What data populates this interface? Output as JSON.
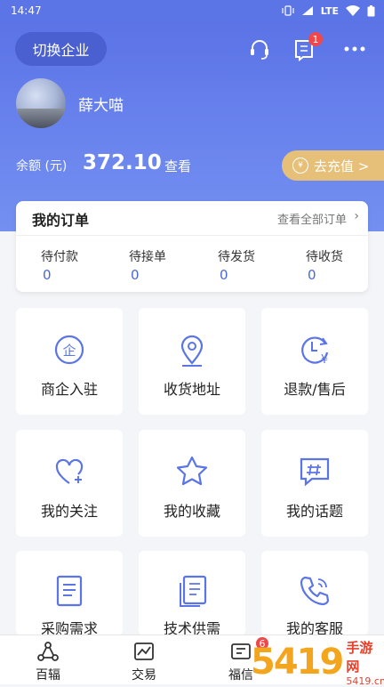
{
  "status_bar": {
    "time": "14:47",
    "network": "LTE"
  },
  "header": {
    "switch_label": "切换企业",
    "message_badge": "1",
    "username": "薛大喵",
    "balance_label": "余额 (元)",
    "balance_value": "372.10",
    "balance_view": "查看",
    "recharge_label": "去充值 >"
  },
  "orders": {
    "title": "我的订单",
    "view_all": "查看全部订单",
    "items": [
      {
        "label": "待付款",
        "count": "0"
      },
      {
        "label": "待接单",
        "count": "0"
      },
      {
        "label": "待发货",
        "count": "0"
      },
      {
        "label": "待收货",
        "count": "0"
      }
    ]
  },
  "grid": [
    {
      "label": "商企入驻",
      "icon": "enterprise-icon"
    },
    {
      "label": "收货地址",
      "icon": "location-pin-icon"
    },
    {
      "label": "退款/售后",
      "icon": "refund-clock-icon"
    },
    {
      "label": "我的关注",
      "icon": "heart-plus-icon"
    },
    {
      "label": "我的收藏",
      "icon": "star-icon"
    },
    {
      "label": "我的话题",
      "icon": "hashtag-chat-icon"
    },
    {
      "label": "采购需求",
      "icon": "document-icon"
    },
    {
      "label": "技术供需",
      "icon": "documents-icon"
    },
    {
      "label": "我的客服",
      "icon": "phone-icon"
    }
  ],
  "tabbar": [
    {
      "label": "百辐",
      "icon": "hub-icon"
    },
    {
      "label": "交易",
      "icon": "trade-chart-icon"
    },
    {
      "label": "福信",
      "icon": "message-icon",
      "badge": "6"
    }
  ],
  "watermark": {
    "big": "5419",
    "top": "手游网",
    "bottom": "5419.cn"
  },
  "colors": {
    "primary": "#5b74e6",
    "accent_gold": "#e6c078",
    "badge_red": "#f04848",
    "count_blue": "#4a67d8"
  }
}
